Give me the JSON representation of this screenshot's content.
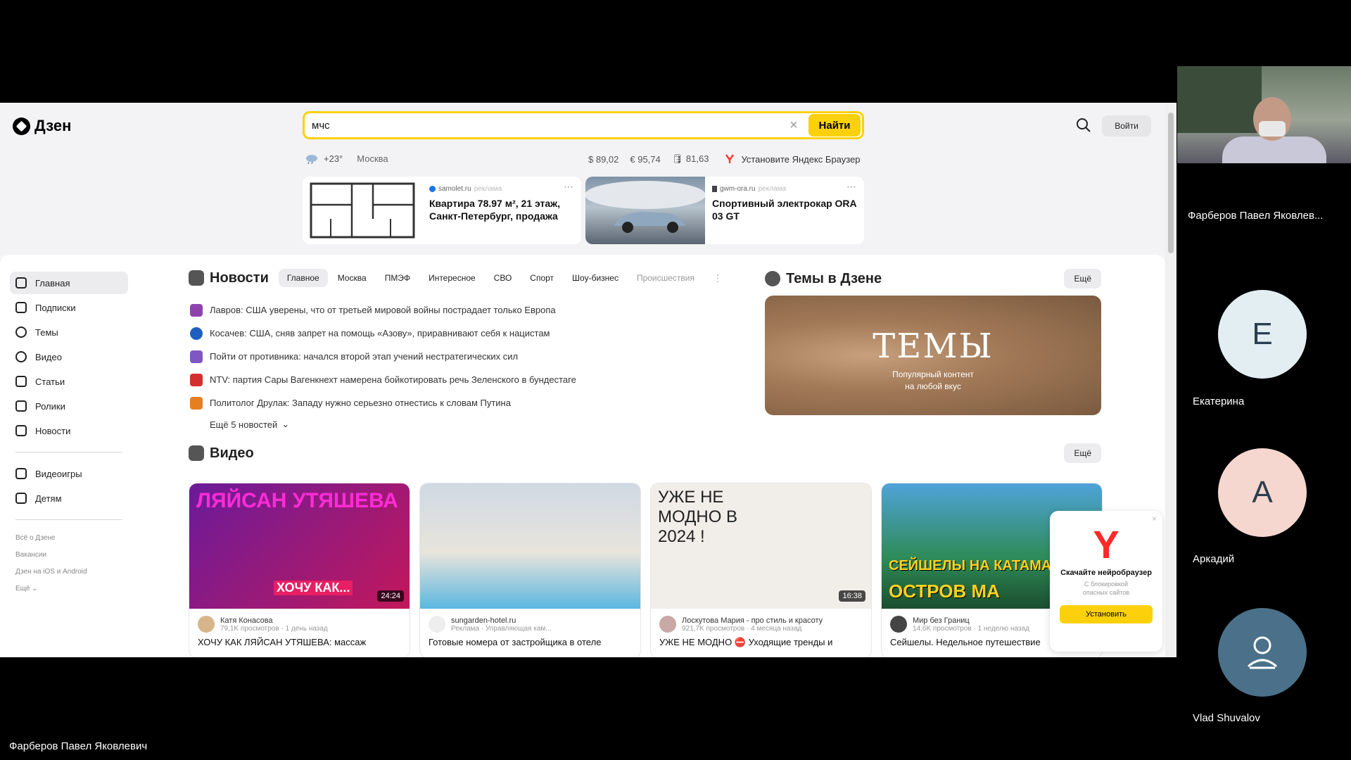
{
  "logo": {
    "text": "Дзен"
  },
  "search": {
    "value": "мчс",
    "button": "Найти"
  },
  "header": {
    "login": "Войти"
  },
  "info": {
    "temp": "+23°",
    "city": "Москва",
    "usd": "$ 89,02",
    "eur": "€ 95,74",
    "oil": "81,63",
    "browser_promo": "Установите Яндекс Браузер"
  },
  "ads": [
    {
      "source": "samolet.ru",
      "tag": "реклама",
      "title": "Квартира 78.97 м², 21 этаж, Санкт-Петербург, продажа"
    },
    {
      "source": "gwm-ora.ru",
      "tag": "реклама",
      "title": "Спортивный электрокар ORA 03 GT"
    }
  ],
  "sidebar": {
    "items": [
      {
        "label": "Главная"
      },
      {
        "label": "Подписки"
      },
      {
        "label": "Темы"
      },
      {
        "label": "Видео"
      },
      {
        "label": "Статьи"
      },
      {
        "label": "Ролики"
      },
      {
        "label": "Новости"
      },
      {
        "label": "Видеоигры"
      },
      {
        "label": "Детям"
      }
    ],
    "footer": [
      "Всё о Дзене",
      "Вакансии",
      "Дзен на iOS и Android",
      "Ещё"
    ]
  },
  "news": {
    "title": "Новости",
    "tabs": [
      "Главное",
      "Москва",
      "ПМЭФ",
      "Интересное",
      "СВО",
      "Спорт",
      "Шоу-бизнес",
      "Происшествия"
    ],
    "items": [
      "Лавров: США уверены, что от третьей мировой войны пострадает только Европа",
      "Косачев: США, сняв запрет на помощь «Азову», приравнивают себя к нацистам",
      "Пойти от противника: начался второй этап учений нестратегических сил",
      "NTV: партия Сары Вагенкнехт намерена бойкотировать речь Зеленского в бундестаге",
      "Политолог Друлак: Западу нужно серьезно отнестись к словам Путина"
    ],
    "more": "Ещё 5 новостей"
  },
  "themes": {
    "title": "Темы в Дзене",
    "more": "Ещё",
    "card_title": "ТЕМЫ",
    "card_sub1": "Популярный контент",
    "card_sub2": "на любой вкус"
  },
  "video": {
    "title": "Видео",
    "more": "Ещё",
    "cards": [
      {
        "thumb_text": "ЛЯЙСАН УТЯШЕВА",
        "thumb_text2": "ХОЧУ КАК...",
        "duration": "24:24",
        "channel": "Катя Конасова",
        "views": "79,1K просмотров · 1 день назад",
        "title": "ХОЧУ КАК ЛЯЙСАН УТЯШЕВА: массаж"
      },
      {
        "thumb_text": "",
        "thumb_text2": "",
        "duration": "",
        "channel": "sungarden-hotel.ru",
        "views": "Реклама · Управляющая кам...",
        "title": "Готовые номера от застройщика в отеле"
      },
      {
        "thumb_text": "УЖЕ НЕ МОДНО В 2024 !",
        "thumb_text2": "",
        "duration": "16:38",
        "channel": "Лоскутова Мария - про стиль и красоту",
        "views": "921,7K просмотров · 4 месяца назад",
        "title": "УЖЕ НЕ МОДНО ⛔ Уходящие тренды и"
      },
      {
        "thumb_text": "СЕЙШЕЛЫ НА КАТАМА",
        "thumb_text2": "ОСТРОВ МА",
        "duration": "",
        "channel": "Мир без Границ",
        "views": "14,6K просмотров · 1 неделю назад",
        "title": "Сейшелы. Недельное путешествие"
      }
    ]
  },
  "popup": {
    "title": "Скачайте нейробраузер",
    "text1": "С блокировкой",
    "text2": "опасных сайтов",
    "button": "Установить"
  },
  "conference": {
    "speaker": "Фарберов Павел Яковлев...",
    "participants": [
      {
        "initial": "Е",
        "name": "Екатерина",
        "color": "#e3eef3"
      },
      {
        "initial": "А",
        "name": "Аркадий",
        "color": "#f5d7cf"
      },
      {
        "initial": "",
        "name": "Vlad Shuvalov",
        "color": "#4a7189"
      }
    ],
    "bottom_label": "Фарберов Павел Яковлевич"
  },
  "icons": [
    "logo-icon",
    "clear-icon",
    "search-icon",
    "weather-icon",
    "oil-icon",
    "yandex-browser-icon",
    "dots-icon",
    "chevron-down-icon",
    "user-icon"
  ],
  "colors": {
    "accent": "#fcd10b",
    "background": "#f5f5f7"
  }
}
